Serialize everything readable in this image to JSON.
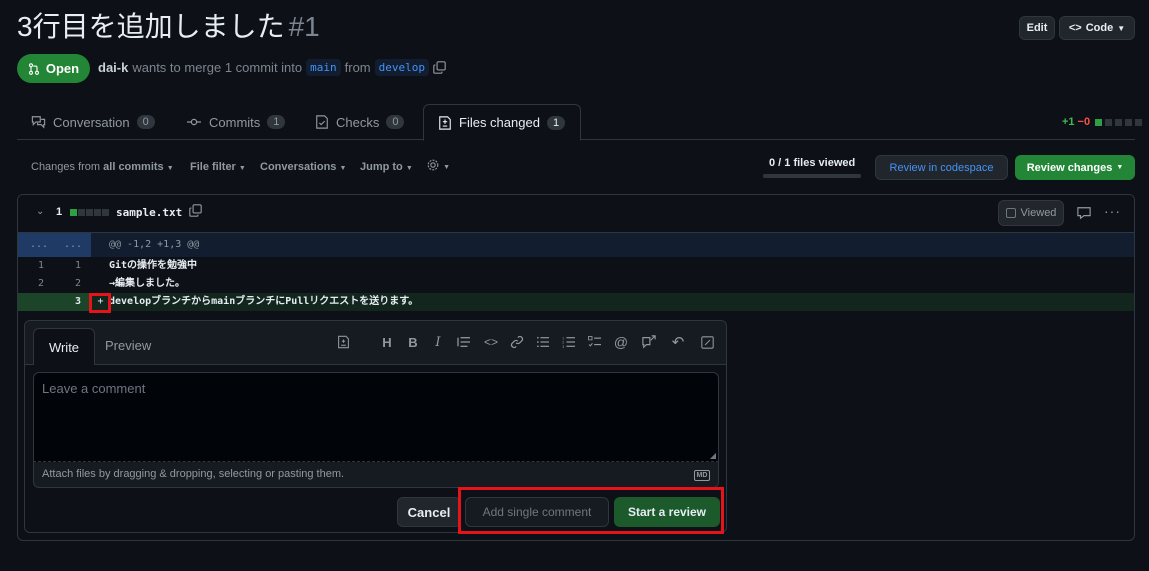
{
  "pr": {
    "title": "3行目を追加しました",
    "number": "#1",
    "state": "Open",
    "author": "dai-k",
    "merge_text": "wants to merge 1 commit into",
    "base_branch": "main",
    "from_text": "from",
    "head_branch": "develop",
    "edit_label": "Edit",
    "code_label": "Code"
  },
  "tabs": [
    {
      "label": "Conversation",
      "count": "0",
      "icon": "comment-discussion-icon"
    },
    {
      "label": "Commits",
      "count": "1",
      "icon": "git-commit-icon"
    },
    {
      "label": "Checks",
      "count": "0",
      "icon": "checklist-icon"
    },
    {
      "label": "Files changed",
      "count": "1",
      "icon": "file-diff-icon"
    }
  ],
  "diffstat": {
    "additions": "+1",
    "deletions": "−0",
    "add_color": "#3fb950",
    "del_color": "#f85149"
  },
  "toolbar": {
    "changes_prefix": "Changes from",
    "changes_value": "all commits",
    "file_filter": "File filter",
    "conversations": "Conversations",
    "jump_to": "Jump to",
    "files_viewed": "0 / 1 files viewed",
    "codespace": "Review in codespace",
    "review_changes": "Review changes"
  },
  "file": {
    "change_count": "1",
    "name": "sample.txt",
    "viewed_label": "Viewed",
    "hunk": "@@ -1,2 +1,3 @@",
    "hunk_dots": "...",
    "lines": [
      {
        "old": "1",
        "new": "1",
        "text": "Gitの操作を勉強中"
      },
      {
        "old": "2",
        "new": "2",
        "text": "→編集しました。"
      },
      {
        "old": "",
        "new": "3",
        "text": "developブランチからmainブランチにPullリクエストを送ります。",
        "marker": "+"
      }
    ]
  },
  "comment": {
    "tab_write": "Write",
    "tab_preview": "Preview",
    "placeholder": "Leave a comment",
    "attach_text": "Attach files by dragging & dropping, selecting or pasting them.",
    "md_label": "MD",
    "cancel": "Cancel",
    "add_single": "Add single comment",
    "start_review": "Start a review"
  }
}
